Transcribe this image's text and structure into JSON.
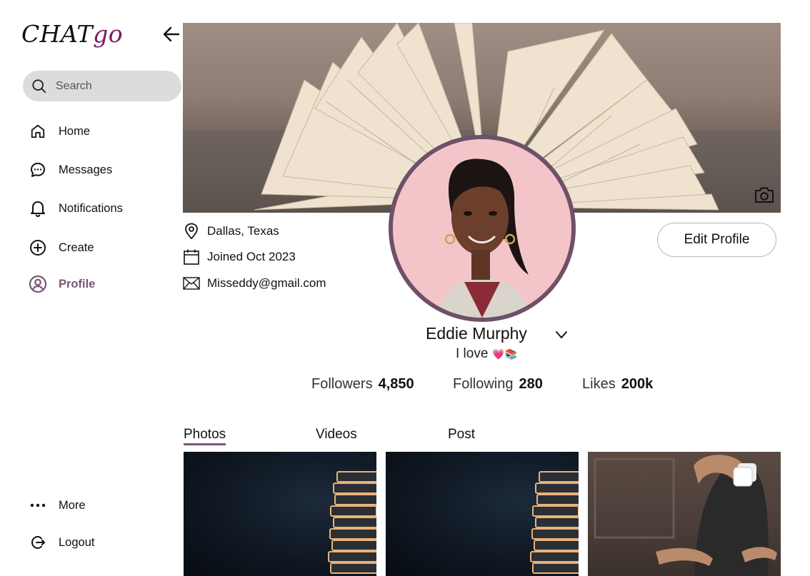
{
  "app": {
    "logo_main": "CHAT",
    "logo_accent": "go"
  },
  "search": {
    "placeholder": "Search"
  },
  "nav": {
    "home": "Home",
    "messages": "Messages",
    "notifications": "Notifications",
    "create": "Create",
    "profile": "Profile",
    "more": "More",
    "logout": "Logout"
  },
  "profile": {
    "location": "Dallas, Texas",
    "joined": "Joined Oct 2023",
    "email": "Misseddy@gmail.com",
    "edit_label": "Edit Profile",
    "name": "Eddie Murphy",
    "bio": "I love",
    "bio_emojis": "💗📚"
  },
  "stats": {
    "followers_label": "Followers",
    "followers_value": "4,850",
    "following_label": "Following",
    "following_value": "280",
    "likes_label": "Likes",
    "likes_value": "200k"
  },
  "tabs": {
    "photos": "Photos",
    "videos": "Videos",
    "post": "Post",
    "active": "Photos"
  },
  "colors": {
    "accent": "#7a5678",
    "logo_accent": "#7a1a63",
    "avatar_ring": "#6e5068",
    "avatar_bg": "#f3c5c9",
    "search_bg": "#dcdcdc"
  },
  "icons": [
    "arrow-left-icon",
    "search-icon",
    "home-icon",
    "message-icon",
    "bell-icon",
    "plus-circle-icon",
    "user-circle-icon",
    "camera-icon",
    "location-pin-icon",
    "calendar-icon",
    "mail-icon",
    "chevron-down-icon",
    "more-dots-icon",
    "logout-icon",
    "multiple-images-icon"
  ]
}
